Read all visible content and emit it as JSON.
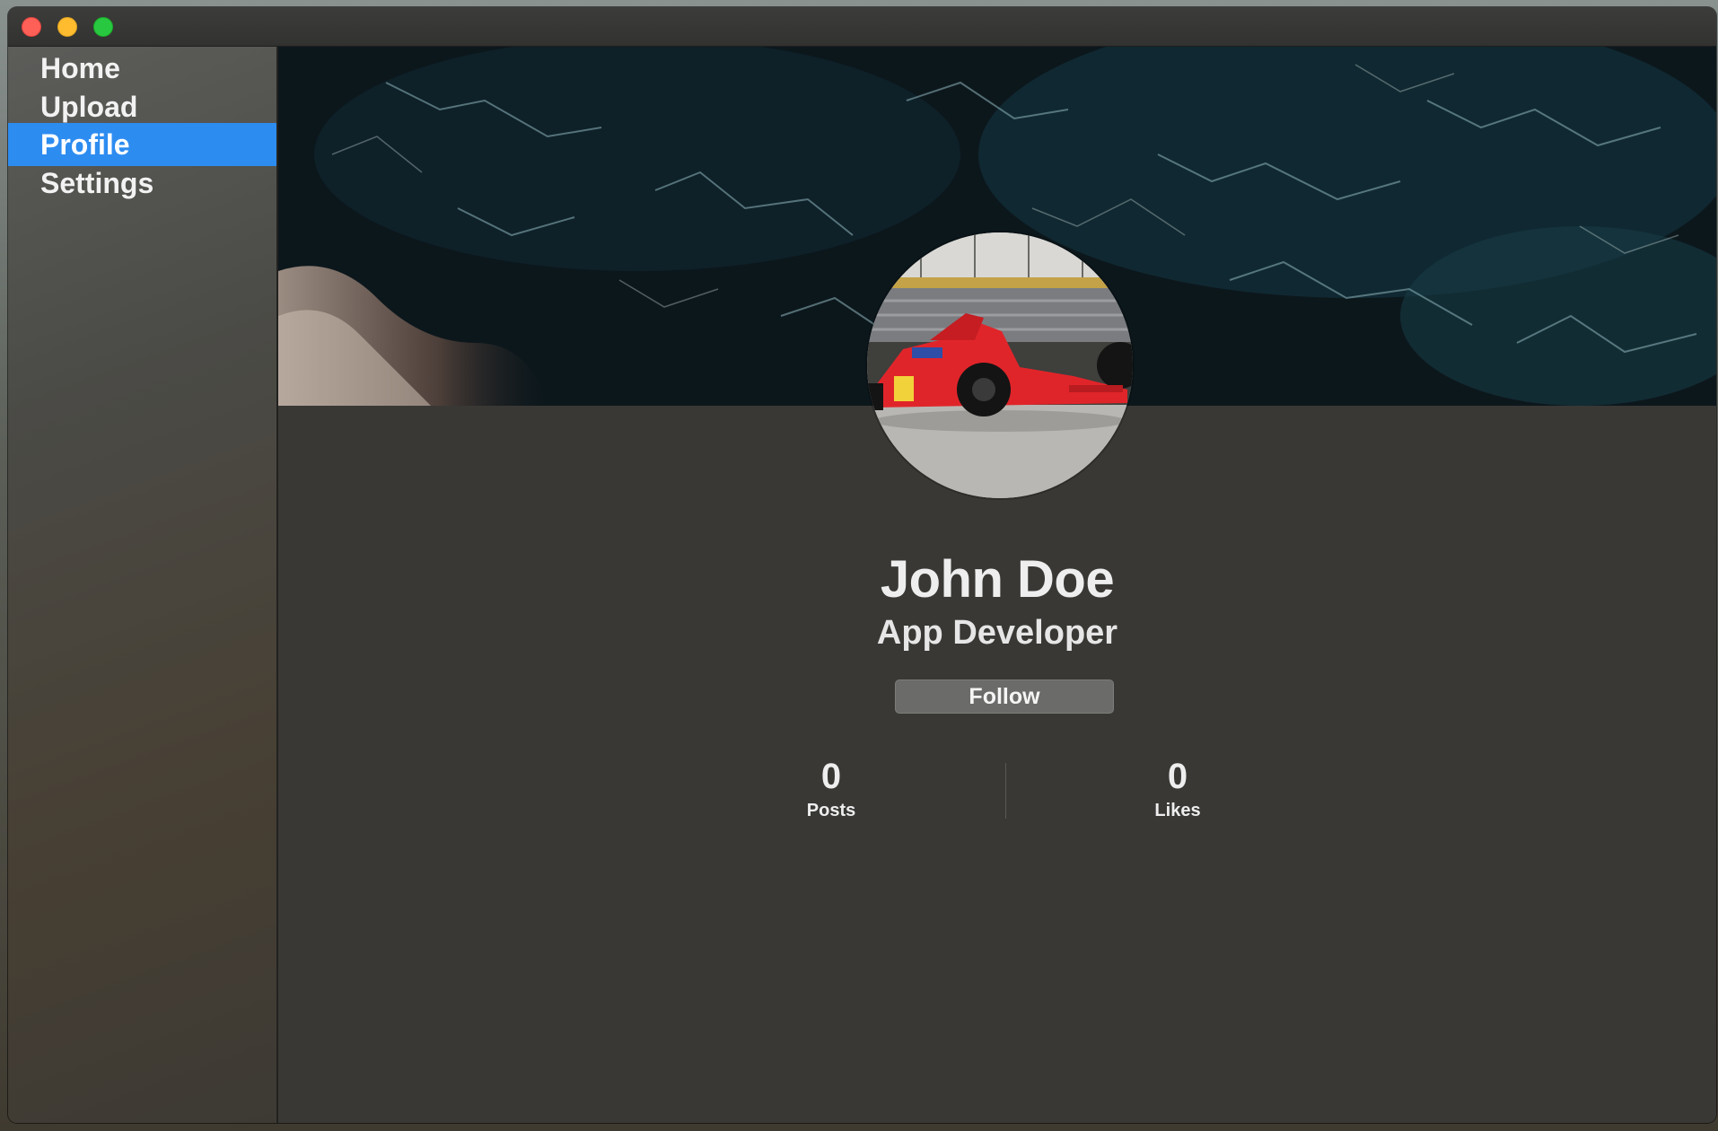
{
  "sidebar": {
    "items": [
      {
        "label": "Home",
        "active": false
      },
      {
        "label": "Upload",
        "active": false
      },
      {
        "label": "Profile",
        "active": true
      },
      {
        "label": "Settings",
        "active": false
      }
    ]
  },
  "profile": {
    "name": "John Doe",
    "title": "App Developer",
    "follow_label": "Follow",
    "stats": [
      {
        "value": "0",
        "label": "Posts"
      },
      {
        "value": "0",
        "label": "Likes"
      }
    ]
  },
  "icons": {
    "window_close": "close-icon",
    "window_minimize": "minimize-icon",
    "window_zoom": "zoom-icon"
  },
  "colors": {
    "accent": "#2d8cf0",
    "background": "#393835",
    "close": "#fe5f57",
    "minimize": "#febc2e",
    "zoom": "#28c840"
  }
}
